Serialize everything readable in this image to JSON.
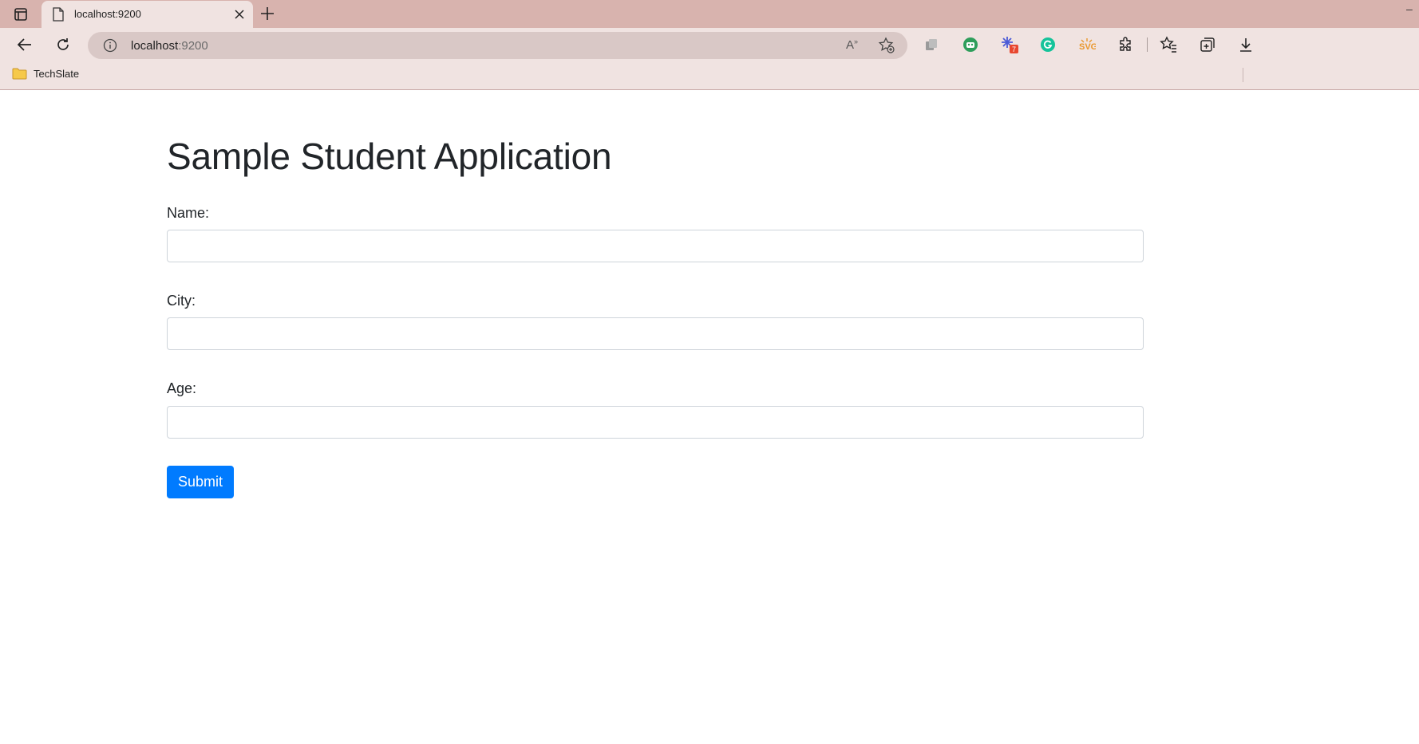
{
  "browser": {
    "tab_title": "localhost:9200",
    "url_host": "localhost",
    "url_port": ":9200",
    "bookmarks": [
      {
        "label": "TechSlate",
        "icon": "folder-icon"
      }
    ],
    "extension_badge": "7",
    "accent_color": "#d8b3ae"
  },
  "page": {
    "heading": "Sample Student Application",
    "fields": [
      {
        "label": "Name:",
        "value": ""
      },
      {
        "label": "City:",
        "value": ""
      },
      {
        "label": "Age:",
        "value": ""
      }
    ],
    "submit_label": "Submit",
    "submit_color": "#007bff"
  }
}
